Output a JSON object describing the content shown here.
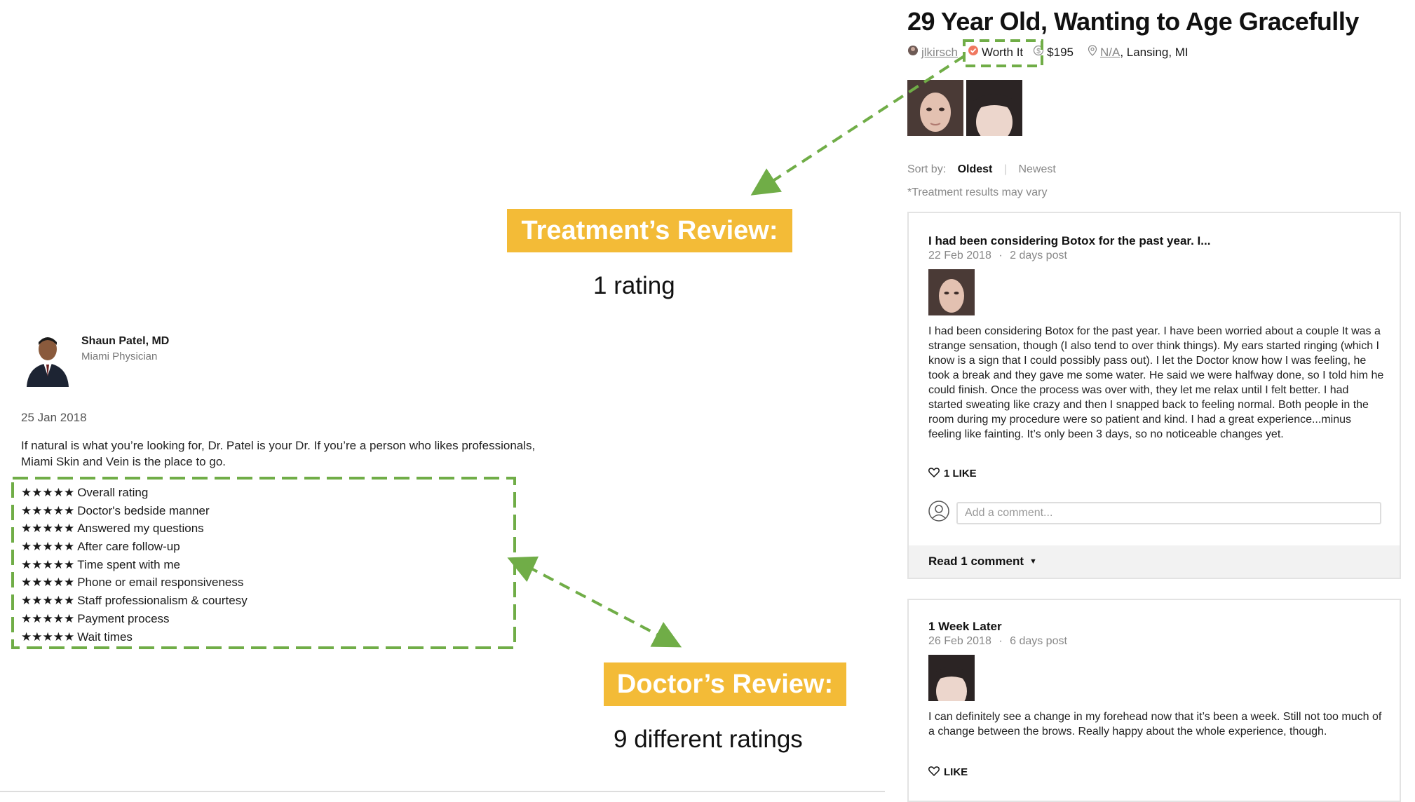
{
  "doctor_review": {
    "name": "Shaun Patel, MD",
    "subtitle": "Miami Physician",
    "date": "25 Jan 2018",
    "text": "If natural is what you’re looking for, Dr. Patel is your Dr. If you’re a person who likes professionals, Miami Skin and Vein is the place to go.",
    "stars": "★★★★★",
    "ratings": [
      "Overall rating",
      "Doctor's bedside manner",
      "Answered my questions",
      "After care follow-up",
      "Time spent with me",
      "Phone or email responsiveness",
      "Staff professionalism & courtesy",
      "Payment process",
      "Wait times"
    ]
  },
  "annotations": {
    "treatment_label": "Treatment’s Review:",
    "treatment_note": "1 rating",
    "doctor_label": "Doctor’s Review:",
    "doctor_note": "9 different ratings",
    "label_color": "#f3bb37",
    "dash_color": "#70ad47"
  },
  "treatment_review": {
    "title": "29 Year Old, Wanting to Age Gracefully",
    "author": "jlkirsch",
    "verdict": "Worth It",
    "price": "$195",
    "location_link": "N/A",
    "location": ", Lansing, MI",
    "sort_label": "Sort by:",
    "sort_options": [
      "Oldest",
      "Newest"
    ],
    "sort_selected": "Oldest",
    "disclaimer": "*Treatment results may vary",
    "posts": [
      {
        "title": "I had been considering Botox for the past year. I...",
        "date": "22 Feb 2018",
        "age": "2 days post",
        "body": "I had been considering Botox for the past year. I have been worried about a couple It was a strange sensation, though (I also tend to over think things). My ears started ringing (which I know is a sign that I could possibly pass out). I let the Doctor know how I was feeling, he took a break and they gave me some water. He said we were halfway done, so I told him he could finish. Once the process was over with, they let me relax until I felt better. I had started sweating like crazy and then I snapped back to feeling normal. Both people in the room during my procedure were so patient and kind. I had a great experience...minus feeling like fainting. It’s only been 3 days, so no noticeable changes yet.",
        "like_label": "1 LIKE",
        "comment_placeholder": "Add a comment...",
        "read_comments": "Read 1 comment"
      },
      {
        "title": "1 Week Later",
        "date": "26 Feb 2018",
        "age": "6 days post",
        "body": "I can definitely see a change in my forehead now that it’s been a week. Still not too much of a change between the brows. Really happy about the whole experience, though.",
        "like_label": "LIKE"
      }
    ]
  },
  "icons": {
    "heart": "heart-outline-icon",
    "user": "user-circle-icon",
    "caret": "caret-down-icon",
    "location": "map-pin-icon",
    "price": "dollar-circle-icon",
    "verdict": "worth-it-icon"
  }
}
